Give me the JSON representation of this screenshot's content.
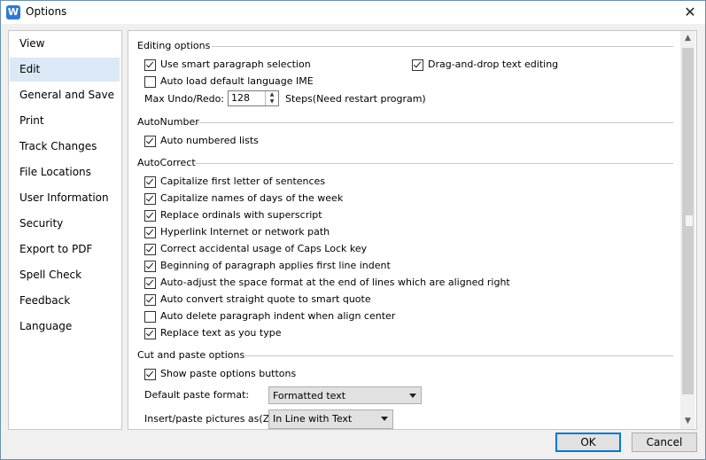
{
  "window": {
    "title": "Options",
    "app_icon": "W",
    "close_icon": "✕"
  },
  "sidebar": {
    "items": [
      {
        "label": "View"
      },
      {
        "label": "Edit"
      },
      {
        "label": "General and Save"
      },
      {
        "label": "Print"
      },
      {
        "label": "Track Changes"
      },
      {
        "label": "File Locations"
      },
      {
        "label": "User Information"
      },
      {
        "label": "Security"
      },
      {
        "label": "Export to PDF"
      },
      {
        "label": "Spell Check"
      },
      {
        "label": "Feedback"
      },
      {
        "label": "Language"
      }
    ],
    "selected": "Edit"
  },
  "editing": {
    "title": "Editing options",
    "smart_paragraph": {
      "label": "Use smart paragraph selection",
      "checked": true
    },
    "drag_drop": {
      "label": "Drag-and-drop text editing",
      "checked": true
    },
    "auto_ime": {
      "label": "Auto load default language IME",
      "checked": false
    },
    "undo_label": "Max Undo/Redo:",
    "undo_value": "128",
    "undo_suffix": "Steps(Need restart program)"
  },
  "autonumber": {
    "title": "AutoNumber",
    "auto_numbered": {
      "label": "Auto numbered lists",
      "checked": true
    }
  },
  "autocorrect": {
    "title": "AutoCorrect",
    "items": [
      {
        "label": "Capitalize first letter of sentences",
        "checked": true
      },
      {
        "label": "Capitalize names of days of the week",
        "checked": true
      },
      {
        "label": "Replace ordinals with superscript",
        "checked": true
      },
      {
        "label": "Hyperlink Internet or network path",
        "checked": true
      },
      {
        "label": "Correct accidental usage of Caps Lock key",
        "checked": true
      },
      {
        "label": "Beginning of paragraph applies first line indent",
        "checked": true
      },
      {
        "label": "Auto-adjust the space format at the end of lines which are aligned right",
        "checked": true
      },
      {
        "label": "Auto convert straight quote to smart quote",
        "checked": true
      },
      {
        "label": "Auto delete paragraph indent when align center",
        "checked": false
      },
      {
        "label": "Replace text as you type",
        "checked": true
      }
    ]
  },
  "cutpaste": {
    "title": "Cut and paste options",
    "show_paste": {
      "label": "Show paste options buttons",
      "checked": true
    },
    "default_format_label": "Default paste format:",
    "default_format_value": "Formatted text",
    "pictures_label": "Insert/paste pictures as(Z):",
    "pictures_value": "In Line with Text"
  },
  "buttons": {
    "ok": "OK",
    "cancel": "Cancel"
  }
}
